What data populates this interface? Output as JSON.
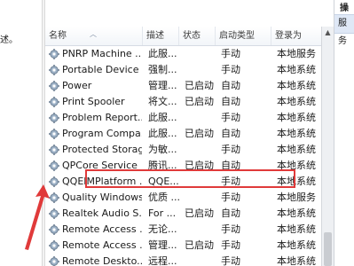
{
  "left_pane": {
    "text": "述。"
  },
  "columns": {
    "name": "名称",
    "description": "描述",
    "status": "状态",
    "startup": "启动类型",
    "logon": "登录为"
  },
  "rows": [
    {
      "name": "PNRP Machine ...",
      "description": "此服...",
      "status": "",
      "startup": "手动",
      "logon": "本地服务"
    },
    {
      "name": "Portable Device ...",
      "description": "强制...",
      "status": "",
      "startup": "手动",
      "logon": "本地系统"
    },
    {
      "name": "Power",
      "description": "管理...",
      "status": "已启动",
      "startup": "自动",
      "logon": "本地系统"
    },
    {
      "name": "Print Spooler",
      "description": "将文...",
      "status": "已启动",
      "startup": "自动",
      "logon": "本地系统"
    },
    {
      "name": "Problem Report...",
      "description": "此服...",
      "status": "",
      "startup": "手动",
      "logon": "本地系统"
    },
    {
      "name": "Program Compa...",
      "description": "此服...",
      "status": "已启动",
      "startup": "自动",
      "logon": "本地系统"
    },
    {
      "name": "Protected Storage",
      "description": "为敏...",
      "status": "",
      "startup": "手动",
      "logon": "本地系统"
    },
    {
      "name": "QPCore Service",
      "description": "腾讯...",
      "status": "已启动",
      "startup": "自动",
      "logon": "本地系统"
    },
    {
      "name": "QQEIMPlatform ...",
      "description": "QQE...",
      "status": "",
      "startup": "手动",
      "logon": "本地系统"
    },
    {
      "name": "Quality Windows...",
      "description": "优质 ...",
      "status": "",
      "startup": "手动",
      "logon": "本地服务"
    },
    {
      "name": "Realtek Audio S...",
      "description": "For ...",
      "status": "已启动",
      "startup": "自动",
      "logon": "本地系统"
    },
    {
      "name": "Remote Access ...",
      "description": "无论...",
      "status": "",
      "startup": "手动",
      "logon": "本地系统"
    },
    {
      "name": "Remote Access ...",
      "description": "管理...",
      "status": "已启动",
      "startup": "手动",
      "logon": "本地系统"
    },
    {
      "name": "Remote Deskto...",
      "description": "远程...",
      "status": "",
      "startup": "手动",
      "logon": "本地系统"
    }
  ],
  "right_pane": {
    "header": "操作",
    "item": "服务"
  },
  "colors": {
    "highlight": "#e03a3a",
    "arrow": "#e03a3a"
  }
}
